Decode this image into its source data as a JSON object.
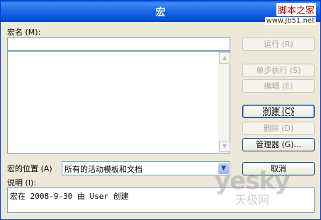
{
  "window": {
    "title": "宏"
  },
  "watermark_top": {
    "site": "脚本之家",
    "url": "www.Jb51.net"
  },
  "macro_name": {
    "label": "宏名 (M):",
    "value": ""
  },
  "buttons": {
    "run": "运行 (R)",
    "step": "单步执行 (S)",
    "edit": "编辑 (E)",
    "create": "创建 (C)",
    "delete": "删除 (D)",
    "organizer": "管理器 (G)...",
    "cancel": "取消"
  },
  "location": {
    "label": "宏的位置 (A)",
    "value": "所有的活动模板和文档"
  },
  "description": {
    "label": "说明 (I):",
    "value": "宏在 2008-9-30 由 User 创建"
  },
  "watermark_bottom": {
    "main": "yesky",
    "sub": "天极网"
  }
}
